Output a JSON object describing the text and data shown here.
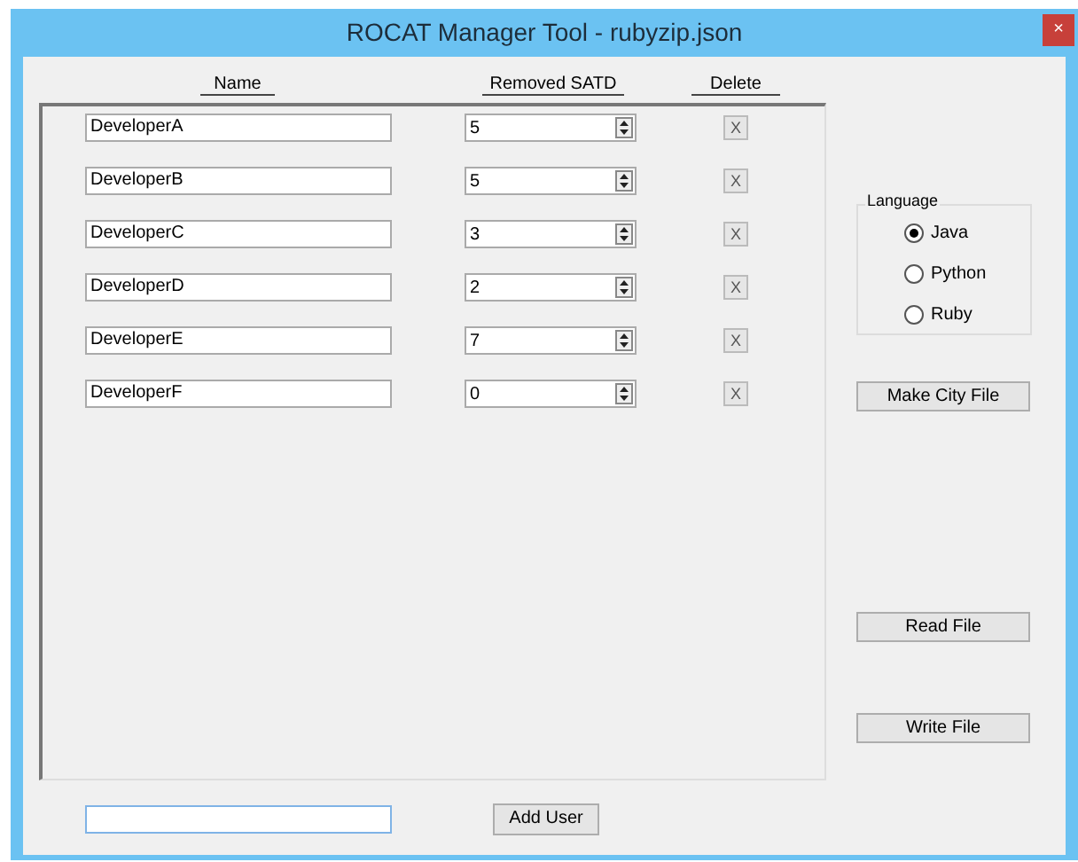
{
  "window": {
    "title": "ROCAT Manager Tool - rubyzip.json",
    "close": "×"
  },
  "columns": [
    "Name",
    "Removed SATD",
    "Delete"
  ],
  "rows": [
    {
      "name": "DeveloperA",
      "removed": "5",
      "delete": "X"
    },
    {
      "name": "DeveloperB",
      "removed": "5",
      "delete": "X"
    },
    {
      "name": "DeveloperC",
      "removed": "3",
      "delete": "X"
    },
    {
      "name": "DeveloperD",
      "removed": "2",
      "delete": "X"
    },
    {
      "name": "DeveloperE",
      "removed": "7",
      "delete": "X"
    },
    {
      "name": "DeveloperF",
      "removed": "0",
      "delete": "X"
    }
  ],
  "language": {
    "title": "Language",
    "options": [
      {
        "label": "Java",
        "selected": true
      },
      {
        "label": "Python",
        "selected": false
      },
      {
        "label": "Ruby",
        "selected": false
      }
    ]
  },
  "buttons": {
    "make_city": "Make City File",
    "read": "Read File",
    "write": "Write File",
    "add_user": "Add User"
  }
}
